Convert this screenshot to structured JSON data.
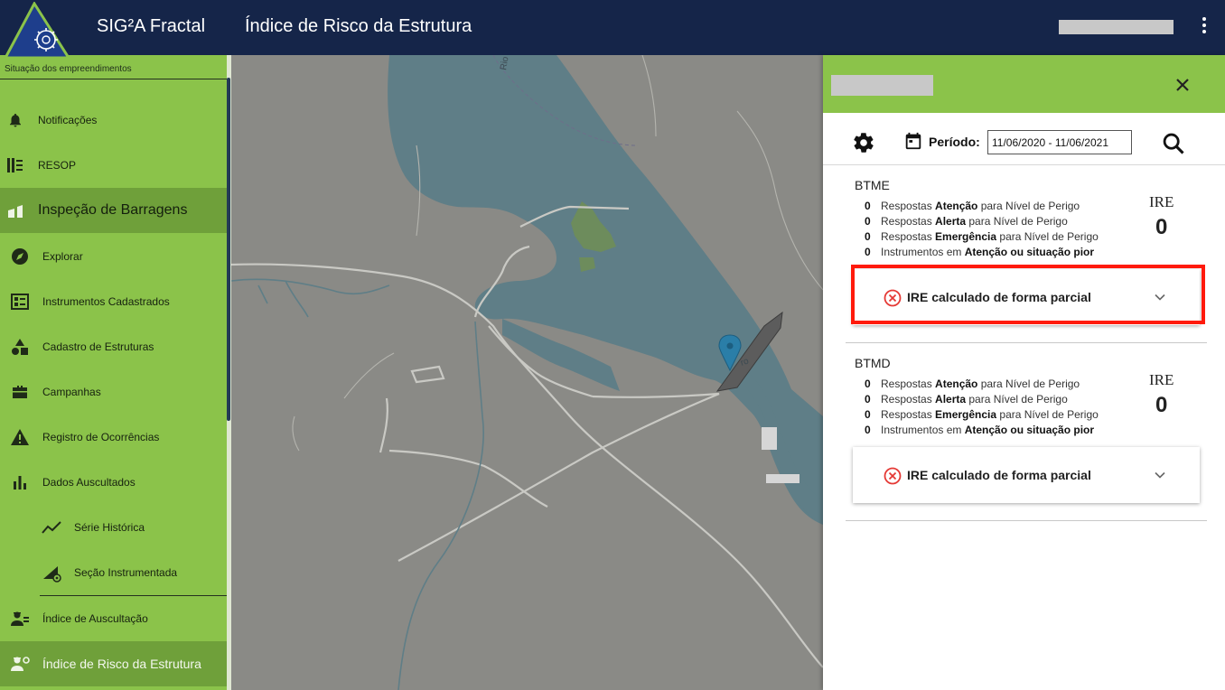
{
  "header": {
    "app_title": "SIG²A Fractal",
    "page_title": "Índice de Risco da Estrutura",
    "logo_icon": "lightbulb-gear-icon",
    "menu_icon": "kebab-menu-icon",
    "background_color": "#152549"
  },
  "sidebar": {
    "situacao": "Situação dos empreendimentos",
    "items": [
      {
        "label": "Notificações",
        "icon": "bell-icon"
      },
      {
        "label": "RESOP",
        "icon": "resop-icon"
      },
      {
        "label": "Inspeção de Barragens",
        "icon": "dam-icon"
      },
      {
        "label": "Explorar",
        "icon": "compass-icon"
      },
      {
        "label": "Instrumentos Cadastrados",
        "icon": "registered-instruments-icon"
      },
      {
        "label": "Cadastro de Estruturas",
        "icon": "shapes-icon"
      },
      {
        "label": "Campanhas",
        "icon": "briefcase-icon"
      },
      {
        "label": "Registro de Ocorrências",
        "icon": "warning-icon"
      },
      {
        "label": "Dados Auscultados",
        "icon": "bar-chart-icon"
      },
      {
        "label": "Série Histórica",
        "icon": "line-chart-icon"
      },
      {
        "label": "Seção Instrumentada",
        "icon": "instrumented-section-icon"
      },
      {
        "label": "Índice de Auscultação",
        "icon": "engineer-icon"
      },
      {
        "label": "Índice de Risco da Estrutura",
        "icon": "engineer-gear-icon"
      }
    ],
    "accent_color": "#8bc34a"
  },
  "panel": {
    "periodo_label": "Período:",
    "periodo_value": "11/06/2020 - 11/06/2021",
    "structures": [
      {
        "name": "BTME",
        "lines": [
          {
            "count": "0",
            "pre": "Respostas ",
            "bold": "Atenção",
            "post": " para Nível de Perigo"
          },
          {
            "count": "0",
            "pre": "Respostas ",
            "bold": "Alerta",
            "post": " para Nível de Perigo"
          },
          {
            "count": "0",
            "pre": "Respostas ",
            "bold": "Emergência",
            "post": " para Nível de Perigo"
          },
          {
            "count": "0",
            "pre": "Instrumentos em ",
            "bold": "Atenção ou situação pior",
            "post": ""
          }
        ],
        "ire_label": "IRE",
        "ire_value": "0",
        "expander_text": "IRE calculado de forma parcial"
      },
      {
        "name": "BTMD",
        "lines": [
          {
            "count": "0",
            "pre": "Respostas ",
            "bold": "Atenção",
            "post": " para Nível de Perigo"
          },
          {
            "count": "0",
            "pre": "Respostas ",
            "bold": "Alerta",
            "post": " para Nível de Perigo"
          },
          {
            "count": "0",
            "pre": "Respostas ",
            "bold": "Emergência",
            "post": " para Nível de Perigo"
          },
          {
            "count": "0",
            "pre": "Instrumentos em ",
            "bold": "Atenção ou situação pior",
            "post": ""
          }
        ],
        "ire_label": "IRE",
        "ire_value": "0",
        "expander_text": "IRE calculado de forma parcial"
      }
    ],
    "error_color": "#e53935",
    "highlight_color": "#ff1a0c"
  },
  "map": {
    "labels": [
      "Rio",
      "ro"
    ],
    "water_color": "#5f7e87",
    "land_color": "#8a8a86"
  }
}
